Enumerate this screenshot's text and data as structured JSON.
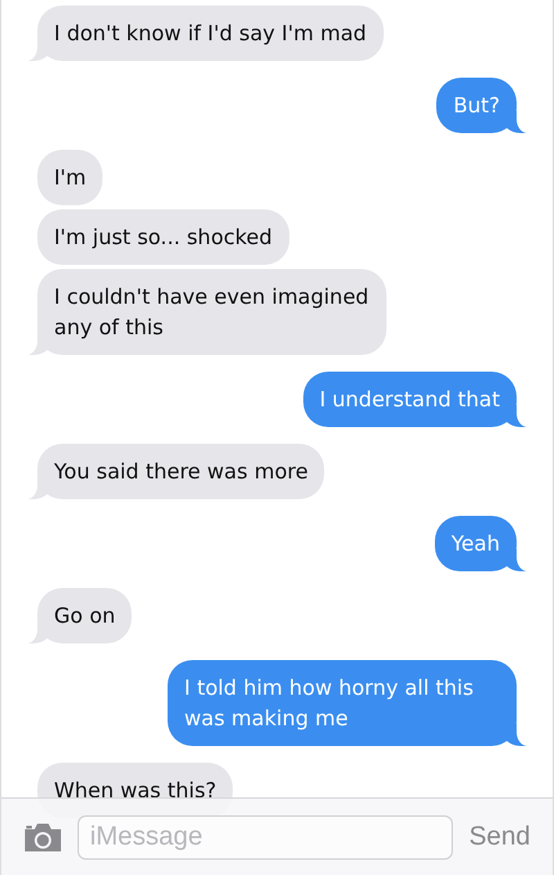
{
  "messages": [
    {
      "kind": "received",
      "text": "I don't know if I'd say I'm mad",
      "tail": true
    },
    {
      "kind": "sent",
      "text": "But?",
      "tail": true
    },
    {
      "kind": "received",
      "text": "I'm",
      "tail": false
    },
    {
      "kind": "received",
      "text": "I'm just so... shocked",
      "tail": false
    },
    {
      "kind": "received",
      "text": "I couldn't have even imagined any of this",
      "tail": true
    },
    {
      "kind": "sent",
      "text": "I understand that",
      "tail": true
    },
    {
      "kind": "received",
      "text": "You said there was more",
      "tail": true
    },
    {
      "kind": "sent",
      "text": "Yeah",
      "tail": true
    },
    {
      "kind": "received",
      "text": "Go on",
      "tail": true
    },
    {
      "kind": "sent",
      "text": "I told him how horny all this was making me",
      "tail": true
    },
    {
      "kind": "received",
      "text": "When was this?"
    }
  ],
  "composer": {
    "placeholder": "iMessage",
    "send_label": "Send"
  }
}
